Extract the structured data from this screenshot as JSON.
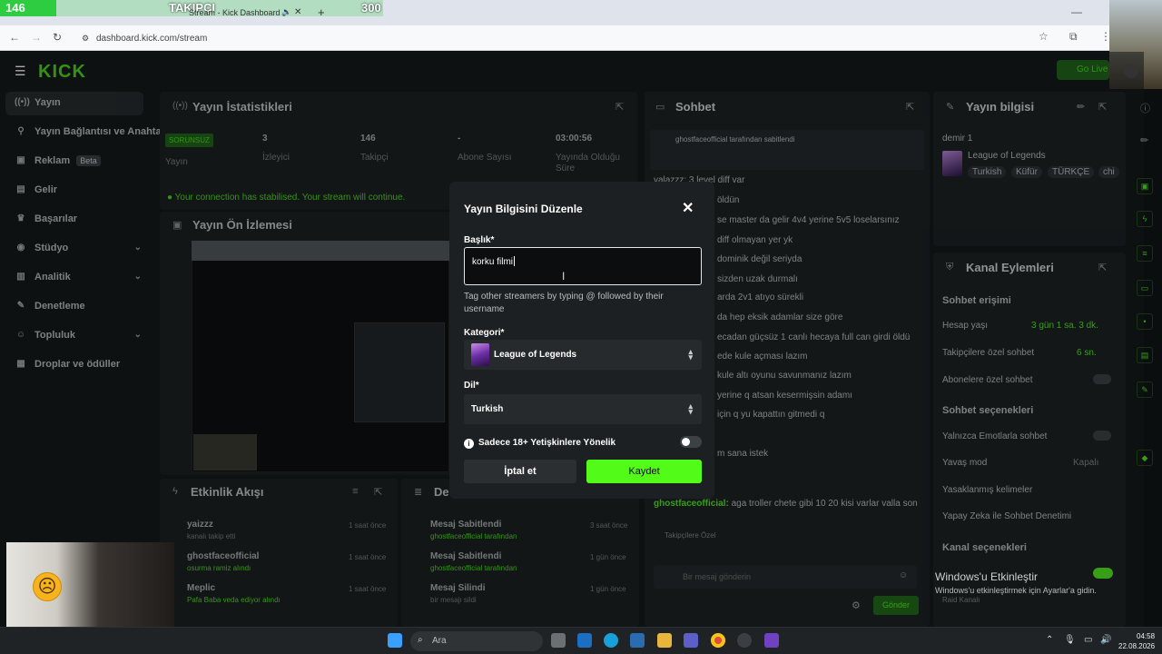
{
  "overlay": {
    "left_count": "146",
    "label": "TAKIPÇI",
    "right_count": "300"
  },
  "browser": {
    "tab_title": "Stream - Kick Dashboard",
    "new_tab": "+",
    "url": "dashboard.kick.com/stream"
  },
  "brand": {
    "logo": "KICK",
    "go_live": "Go Live"
  },
  "sidebar": {
    "items": [
      {
        "label": "Yayın",
        "icon": "broadcast-icon"
      },
      {
        "label": "Yayın Bağlantısı ve Anahtarı",
        "icon": "link-icon"
      },
      {
        "label": "Reklam",
        "badge": "Beta",
        "icon": "ad-icon"
      },
      {
        "label": "Gelir",
        "icon": "wallet-icon"
      },
      {
        "label": "Başarılar",
        "icon": "trophy-icon"
      },
      {
        "label": "Stüdyo",
        "icon": "studio-icon"
      },
      {
        "label": "Analitik",
        "icon": "analytics-icon"
      },
      {
        "label": "Denetleme",
        "icon": "wrench-icon"
      },
      {
        "label": "Topluluk",
        "icon": "community-icon"
      },
      {
        "label": "Droplar ve ödüller",
        "icon": "gift-icon"
      }
    ]
  },
  "stats": {
    "title": "Yayın İstatistikleri",
    "status": "SORUNSUZ",
    "cols": [
      {
        "value": "3",
        "label": "İzleyici"
      },
      {
        "value": "146",
        "label": "Takipçi"
      },
      {
        "value": "-",
        "label": "Abone Sayısı"
      },
      {
        "value": "03:00:56",
        "label": "Yayında Olduğu Süre"
      }
    ],
    "notice": "Your connection has stabilised. Your stream will continue."
  },
  "preview": {
    "title": "Yayın Ön İzlemesi"
  },
  "activity": {
    "title": "Etkinlik Akışı",
    "items": [
      {
        "user": "yaizzz",
        "desc": "kanalı takip etti",
        "time": "1 saat önce"
      },
      {
        "user": "ghostfaceofficial",
        "desc": "osurma ramiz alındı",
        "time": "1 saat önce"
      },
      {
        "user": "Meplic",
        "desc": "Pafa Baba veda ediyor alındı",
        "time": "1 saat önce"
      }
    ]
  },
  "modlog": {
    "title": "De",
    "items": [
      {
        "title": "Mesaj Sabitlendi",
        "desc": "ghostfaceofficial tarafından",
        "time": "3 saat önce"
      },
      {
        "title": "Mesaj Sabitlendi",
        "desc": "ghostfaceofficial tarafından",
        "time": "1 gün önce"
      },
      {
        "title": "Mesaj Silindi",
        "desc": "bir mesajı sildi",
        "time": "1 gün önce"
      }
    ]
  },
  "chat": {
    "title": "Sohbet",
    "pinned_by": "ghostfaceofficial tarafından sabitlendi",
    "lines": [
      "yalazzz: 3 level diff var",
      "öldün",
      "se master da gelir 4v4 yerine 5v5 loselarsınız",
      "diff olmayan yer yk",
      "dominik değil seriyda",
      "sizden uzak durmalı",
      "arda 2v1 atıyo sürekli",
      "da hep eksik adamlar size göre",
      "ecadan güçsüz 1 canlı hecaya full can girdi öldü",
      "ede kule açması lazım",
      "kule altı oyunu savunmanız lazım",
      "yerine q atsan kesermişsin adamı",
      "için q yu kapattın gitmedi q",
      "m sana istek"
    ],
    "last_user": "ghostfaceofficial:",
    "last_msg": "aga troller chete gibi 10 20 kisi varlar valla son",
    "followers_only": "Takipçilere Özel",
    "input_placeholder": "Bir mesaj gönderin",
    "send": "Gönder"
  },
  "stream_info": {
    "title": "Yayın bilgisi",
    "stream_title": "demir 1",
    "category": "League of Legends",
    "tags": [
      "Turkish",
      "Küfür",
      "TÜRKÇE",
      "chi"
    ]
  },
  "channel_actions": {
    "title": "Kanal Eylemleri",
    "chat_access": "Sohbet erişimi",
    "account_age": {
      "label": "Hesap yaşı",
      "value": "3 gün 1 sa. 3 dk."
    },
    "followers_chat": {
      "label": "Takipçilere özel sohbet",
      "value": "6 sn."
    },
    "subs_chat": "Abonelere özel sohbet",
    "chat_options": "Sohbet seçenekleri",
    "emote_only": "Yalnızca Emotlarla sohbet",
    "slow_mode": {
      "label": "Yavaş mod",
      "value": "Kapalı"
    },
    "banned_words": "Yasaklanmış kelimeler",
    "ai_mod": "Yapay Zeka ile Sohbet Denetimi",
    "channel_options": "Kanal seçenekleri",
    "raid": "Raid Kanalı"
  },
  "modal": {
    "title": "Yayın Bilgisini Düzenle",
    "title_label": "Başlık*",
    "title_value": "korku filmi",
    "help": "Tag other streamers by typing @ followed by their username",
    "category_label": "Kategori*",
    "category_value": "League of Legends",
    "language_label": "Dil*",
    "language_value": "Turkish",
    "adult_label": "Sadece 18+ Yetişkinlere Yönelik",
    "cancel": "İptal et",
    "save": "Kaydet"
  },
  "watermark": {
    "line1": "Windows'u Etkinleştir",
    "line2": "Windows'u etkinleştirmek için Ayarlar'a gidin."
  },
  "taskbar": {
    "search": "Ara",
    "time": "04:58",
    "date": "22.08.2026"
  },
  "colors": {
    "accent": "#53fc18",
    "modal_bg": "#1c2023",
    "page_bg": "#0b0e0f"
  }
}
